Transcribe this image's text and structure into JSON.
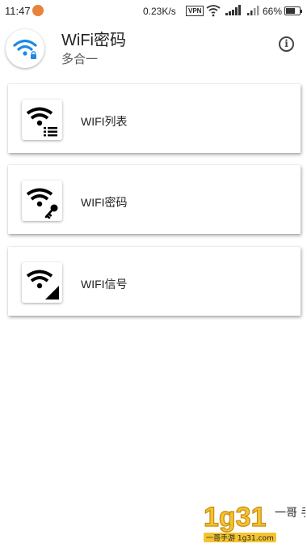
{
  "status_bar": {
    "time": "11:47",
    "speed": "0.23K/s",
    "vpn": "VPN",
    "battery_percent": "66%",
    "battery_level": 0.66
  },
  "header": {
    "title": "WiFi密码",
    "subtitle": "多合一",
    "info_icon": "info-icon",
    "info_glyph": "i"
  },
  "menu": {
    "items": [
      {
        "label": "WIFI列表",
        "icon": "wifi-list-icon"
      },
      {
        "label": "WIFI密码",
        "icon": "wifi-key-icon"
      },
      {
        "label": "WIFI信号",
        "icon": "wifi-signal-icon"
      }
    ]
  },
  "watermark": {
    "brand": "1g31",
    "text_right": "一哥 手游",
    "tagline": "一哥手游 1g31.com"
  },
  "colors": {
    "accent": "#1e88e5",
    "text": "#222222",
    "subtext": "#555555"
  }
}
